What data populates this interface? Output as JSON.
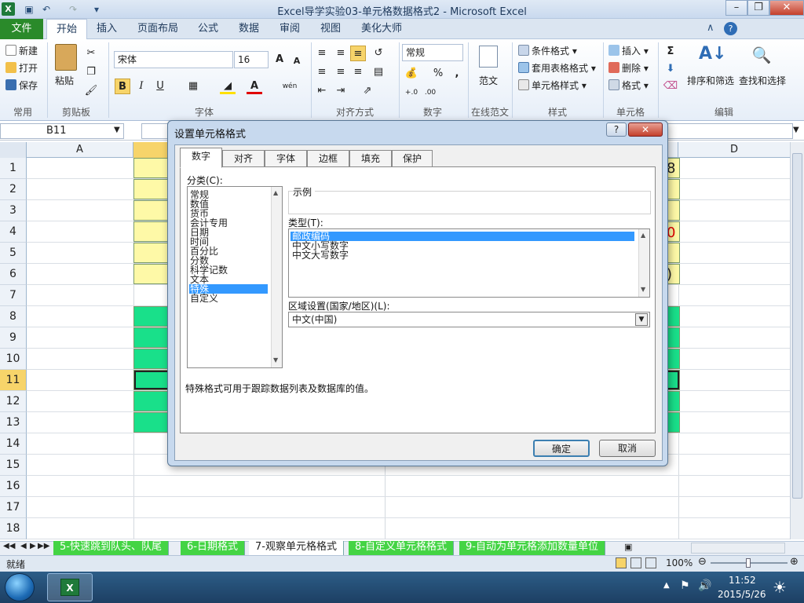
{
  "window": {
    "title": "Excel导学实验03-单元格数据格式2 - Microsoft Excel",
    "app_icon": "X"
  },
  "menu": {
    "file": "文件",
    "tabs": [
      "开始",
      "插入",
      "页面布局",
      "公式",
      "数据",
      "审阅",
      "视图",
      "美化大师"
    ]
  },
  "ribbon": {
    "clipboard": {
      "new": "新建",
      "open": "打开",
      "save": "保存",
      "group_common": "常用",
      "paste": "粘贴",
      "group": "剪贴板"
    },
    "font": {
      "name": "宋体",
      "size": "16",
      "bold": "B",
      "italic": "I",
      "underline": "U",
      "increase": "A",
      "decrease": "A",
      "phonetic": "wén",
      "group": "字体"
    },
    "align": {
      "group": "对齐方式"
    },
    "number": {
      "format": "常规",
      "percent": "%",
      "comma": ",",
      "inc_dec": "+.0\n.00",
      "dec_dec": ".00\n+.0",
      "group": "数字"
    },
    "online": {
      "label": "范文",
      "group": "在线范文"
    },
    "styles": {
      "conditional": "条件格式",
      "table": "套用表格格式",
      "cell": "单元格样式",
      "group": "样式"
    },
    "cells": {
      "insert": "插入",
      "delete": "删除",
      "format": "格式",
      "group": "单元格"
    },
    "editing": {
      "sigma": "Σ",
      "sort": "排序和筛选",
      "find": "查找和选择",
      "group": "编辑"
    }
  },
  "formula_bar": {
    "name_box": "B11"
  },
  "grid": {
    "columns": [
      "A",
      "D"
    ],
    "rows": [
      "1",
      "2",
      "3",
      "4",
      "5",
      "6",
      "7",
      "8",
      "9",
      "10",
      "11",
      "12",
      "13",
      "14",
      "15",
      "16",
      "17",
      "18"
    ],
    "partial_values": {
      "c1": "8",
      "c4": "0",
      "c6": ")"
    },
    "colors": {
      "yellow": "#fef9a7",
      "green": "#19e08a"
    }
  },
  "sheet_tabs": [
    "5-快速跳到队头、队尾",
    "6-日期格式",
    "7-观察单元格格式",
    "8-自定义单元格格式",
    "9-自动为单元格添加数量单位"
  ],
  "status": {
    "ready": "就绪",
    "zoom": "100%"
  },
  "taskbar": {
    "time": "11:52",
    "date": "2015/5/26"
  },
  "dialog": {
    "title": "设置单元格格式",
    "help": "?",
    "close": "✕",
    "tabs": [
      "数字",
      "对齐",
      "字体",
      "边框",
      "填充",
      "保护"
    ],
    "category_label": "分类(C):",
    "categories": [
      "常规",
      "数值",
      "货币",
      "会计专用",
      "日期",
      "时间",
      "百分比",
      "分数",
      "科学记数",
      "文本",
      "特殊",
      "自定义"
    ],
    "selected_category": "特殊",
    "sample_label": "示例",
    "type_label": "类型(T):",
    "types": [
      "邮政编码",
      "中文小写数字",
      "中文大写数字"
    ],
    "locale_label": "区域设置(国家/地区)(L):",
    "locale_value": "中文(中国)",
    "description": "特殊格式可用于跟踪数据列表及数据库的值。",
    "ok": "确定",
    "cancel": "取消"
  }
}
